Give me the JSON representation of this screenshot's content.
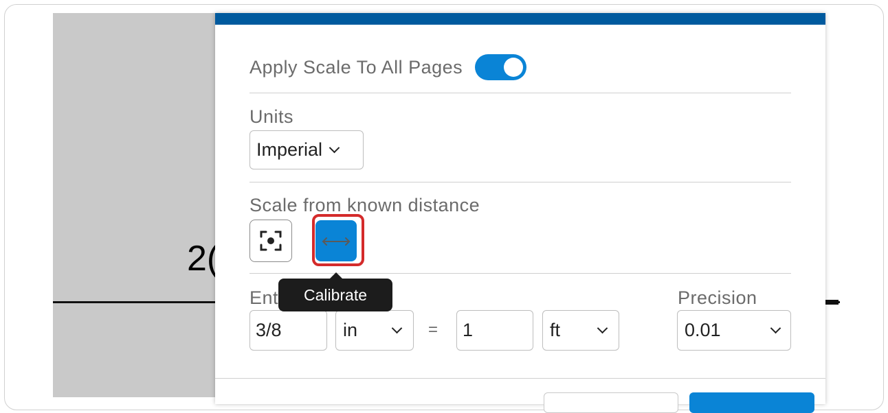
{
  "document": {
    "visible_text_fragment": "2("
  },
  "dialog": {
    "apply_scale_label": "Apply Scale To All Pages",
    "apply_scale_on": true,
    "units": {
      "label": "Units",
      "selected": "Imperial"
    },
    "scale_section": {
      "label": "Scale from known distance",
      "buttons": [
        {
          "name": "focus-icon"
        },
        {
          "name": "calibrate-arrows-icon",
          "active": true
        }
      ],
      "tooltip": "Calibrate"
    },
    "enter_label": "Ent",
    "precision_label": "Precision",
    "ratio": {
      "left_value": "3/8",
      "left_unit": "in",
      "equals": "=",
      "right_value": "1",
      "right_unit": "ft"
    },
    "precision_value": "0.01"
  },
  "colors": {
    "accent": "#0a84d6",
    "header_bar": "#005a9e",
    "highlight_outline": "#d42b2b"
  }
}
